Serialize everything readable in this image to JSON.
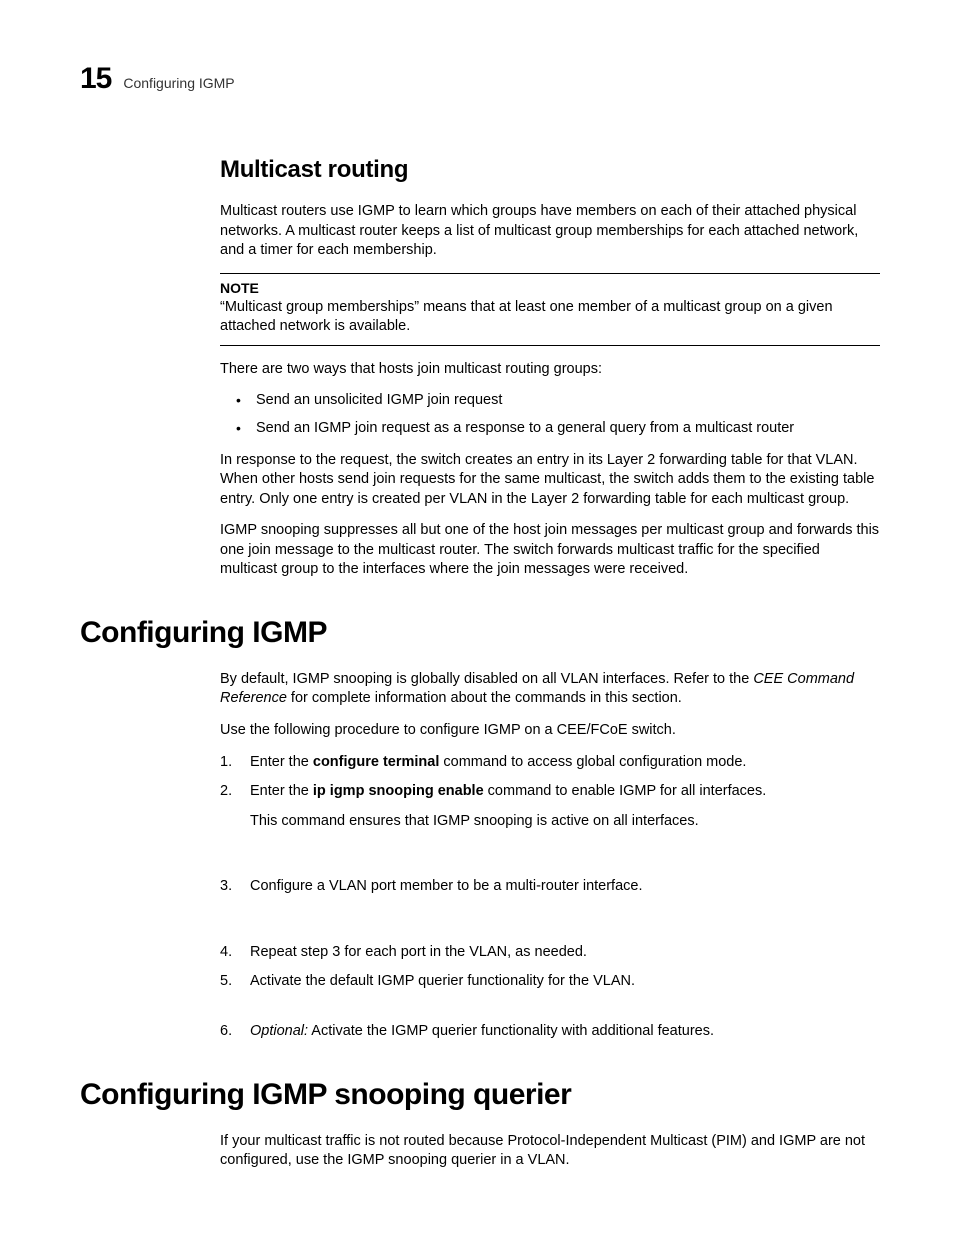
{
  "header": {
    "chapter_number": "15",
    "title": "Configuring IGMP"
  },
  "section_multicast": {
    "heading": "Multicast routing",
    "para1": "Multicast routers use IGMP to learn which groups have members on each of their attached physical networks. A multicast router keeps a list of multicast group memberships for each attached network, and a timer for each membership.",
    "note_label": "NOTE",
    "note_text": "“Multicast group memberships” means that at least one member of a multicast group on a given attached network is available.",
    "para2": "There are two ways that hosts join multicast routing groups:",
    "bullets": [
      "Send an unsolicited IGMP join request",
      "Send an IGMP join request as a response to a general query from a multicast router"
    ],
    "para3": "In response to the request, the switch creates an entry in its Layer 2 forwarding table for that VLAN. When other hosts send join requests for the same multicast, the switch adds them to the existing table entry. Only one entry is created per VLAN in the Layer 2 forwarding table for each multicast group.",
    "para4": "IGMP snooping suppresses all but one of the host join messages per multicast group and forwards this one join message to the multicast router. The switch forwards multicast traffic for the specified multicast group to the interfaces where the join messages were received."
  },
  "section_config": {
    "heading": "Configuring IGMP",
    "para1_a": "By default, IGMP snooping is globally disabled on all VLAN interfaces. Refer to the ",
    "para1_ref": "CEE Command Reference",
    "para1_b": " for complete information about the commands in this section.",
    "para2": "Use the following procedure to configure IGMP on a CEE/FCoE switch.",
    "step1_a": "Enter the ",
    "step1_cmd": "configure terminal",
    "step1_b": " command to access global configuration mode.",
    "step2_a": "Enter the ",
    "step2_cmd": "ip igmp snooping enable",
    "step2_b": " command to enable IGMP for all interfaces.",
    "step2_sub": "This command ensures that IGMP snooping is active on all interfaces.",
    "step3": "Configure a VLAN port member to be a multi-router interface.",
    "step4": "Repeat step 3 for each port in the VLAN, as needed.",
    "step5": "Activate the default IGMP querier functionality for the VLAN.",
    "step6_a": "Optional:",
    "step6_b": " Activate the IGMP querier functionality with additional features."
  },
  "section_querier": {
    "heading": "Configuring IGMP snooping querier",
    "para1": "If your multicast traffic is not routed because Protocol-Independent Multicast (PIM) and IGMP are not configured, use the IGMP snooping querier in a VLAN."
  }
}
